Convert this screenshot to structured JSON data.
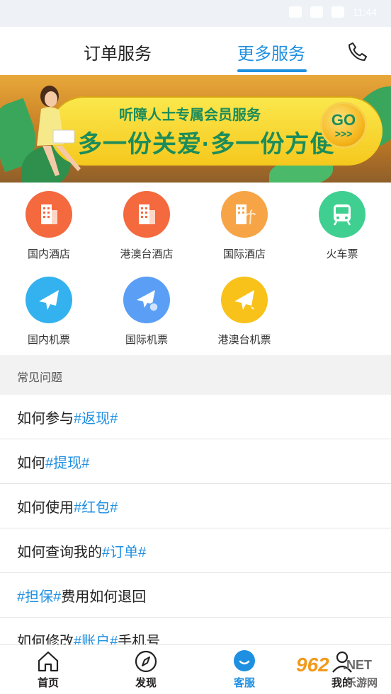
{
  "status_bar": {
    "time": "11:44"
  },
  "tabs": {
    "order_service": "订单服务",
    "more_service": "更多服务"
  },
  "banner": {
    "subtitle": "听障人士专属会员服务",
    "headline": "多一份关爱·多一份方便",
    "go_label": "GO",
    "go_arrows": ">>>"
  },
  "services": [
    {
      "label": "国内酒店",
      "icon": "hotel-icon",
      "color": "#f4693e"
    },
    {
      "label": "港澳台酒店",
      "icon": "hotel-icon",
      "color": "#f4693e"
    },
    {
      "label": "国际酒店",
      "icon": "resort-hotel-icon",
      "color": "#f7a447"
    },
    {
      "label": "火车票",
      "icon": "train-icon",
      "color": "#3fcf91"
    },
    {
      "label": "国内机票",
      "icon": "airplane-icon",
      "color": "#34b2ef"
    },
    {
      "label": "国际机票",
      "icon": "international-flight-icon",
      "color": "#5a9ff5"
    },
    {
      "label": "港澳台机票",
      "icon": "airplane-icon",
      "color": "#f8c21b"
    }
  ],
  "faq": {
    "header": "常见问题",
    "items": [
      {
        "pre": "如何参与",
        "kw": "#返现#",
        "post": ""
      },
      {
        "pre": "如何",
        "kw": "#提现#",
        "post": ""
      },
      {
        "pre": "如何使用",
        "kw": "#红包#",
        "post": ""
      },
      {
        "pre": "如何查询我的",
        "kw": "#订单#",
        "post": ""
      },
      {
        "pre": "",
        "kw": "#担保#",
        "post": "费用如何退回"
      },
      {
        "pre": "如何修改",
        "kw": "#账户#",
        "post": "手机号"
      }
    ]
  },
  "bottom_nav": {
    "home": "首页",
    "discover": "发现",
    "service": "客服",
    "mine": "我的"
  },
  "watermark": {
    "num": "962",
    "net": ".NET",
    "cn": "乐游网"
  },
  "colors": {
    "accent": "#1e8fe1"
  }
}
